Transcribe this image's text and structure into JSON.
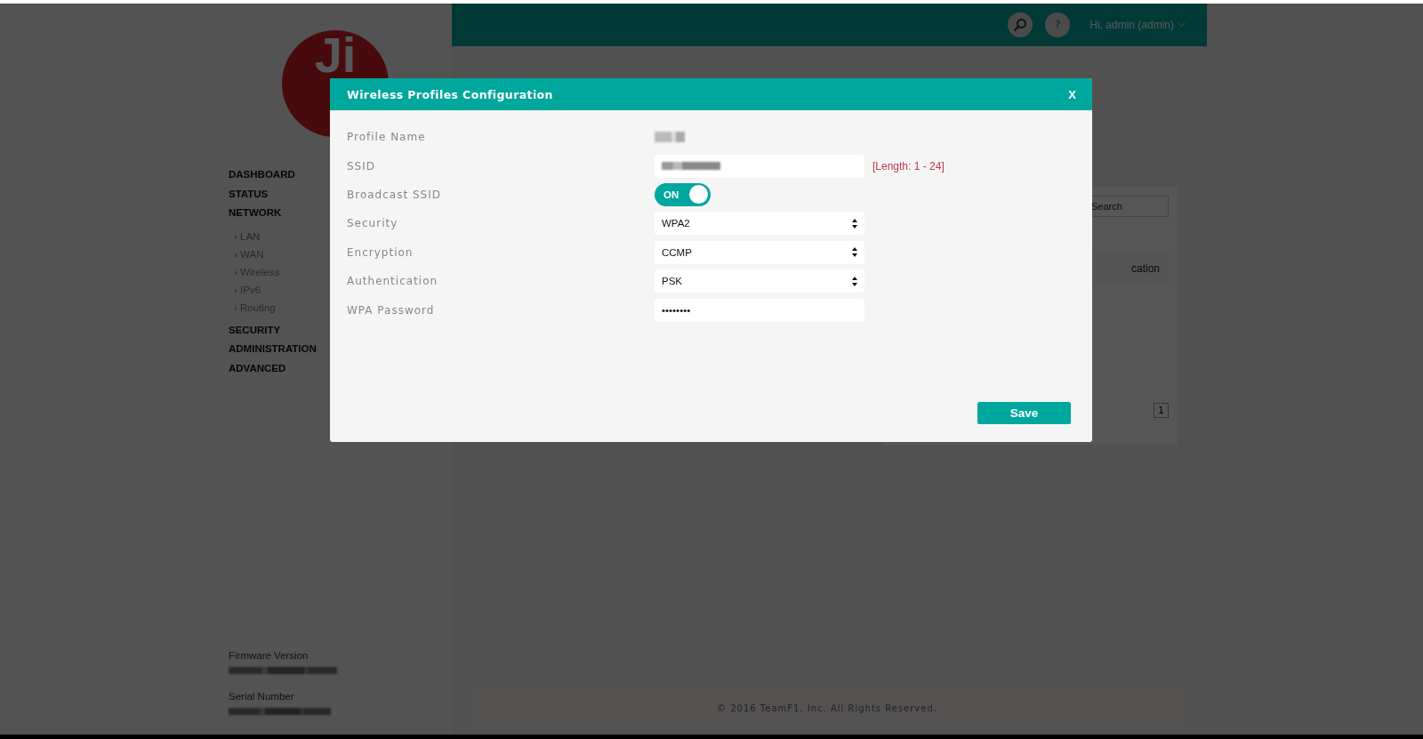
{
  "sidebar": {
    "logo": "Ji",
    "items": [
      {
        "label": "DASHBOARD"
      },
      {
        "label": "STATUS"
      },
      {
        "label": "NETWORK",
        "children": [
          {
            "label": "LAN"
          },
          {
            "label": "WAN"
          },
          {
            "label": "Wireless"
          },
          {
            "label": "IPv6"
          },
          {
            "label": "Routing"
          }
        ]
      },
      {
        "label": "SECURITY"
      },
      {
        "label": "ADMINISTRATION"
      },
      {
        "label": "ADVANCED"
      }
    ],
    "sub_marker": "›",
    "info": [
      {
        "label": "Firmware Version"
      },
      {
        "label": "Serial Number"
      }
    ]
  },
  "header": {
    "help": "?",
    "user": "Hi, admin (admin)"
  },
  "panel": {
    "search_placeholder": "Search",
    "column_partial": "cation",
    "pages": [
      "1"
    ]
  },
  "footer": "© 2016 TeamF1, Inc. All Rights Reserved.",
  "modal": {
    "title": "Wireless Profiles Configuration",
    "close": "X",
    "save": "Save",
    "fields": [
      {
        "label": "Profile Name",
        "kind": "static"
      },
      {
        "label": "SSID",
        "kind": "input",
        "note": "[Length: 1 - 24]"
      },
      {
        "label": "Broadcast SSID",
        "kind": "toggle",
        "on": true,
        "toggle_text": "ON"
      },
      {
        "label": "Security",
        "kind": "select",
        "value": "WPA2"
      },
      {
        "label": "Encryption",
        "kind": "select",
        "value": "CCMP"
      },
      {
        "label": "Authentication",
        "kind": "select",
        "value": "PSK"
      },
      {
        "label": "WPA Password",
        "kind": "password",
        "value": "••••••••"
      }
    ]
  }
}
